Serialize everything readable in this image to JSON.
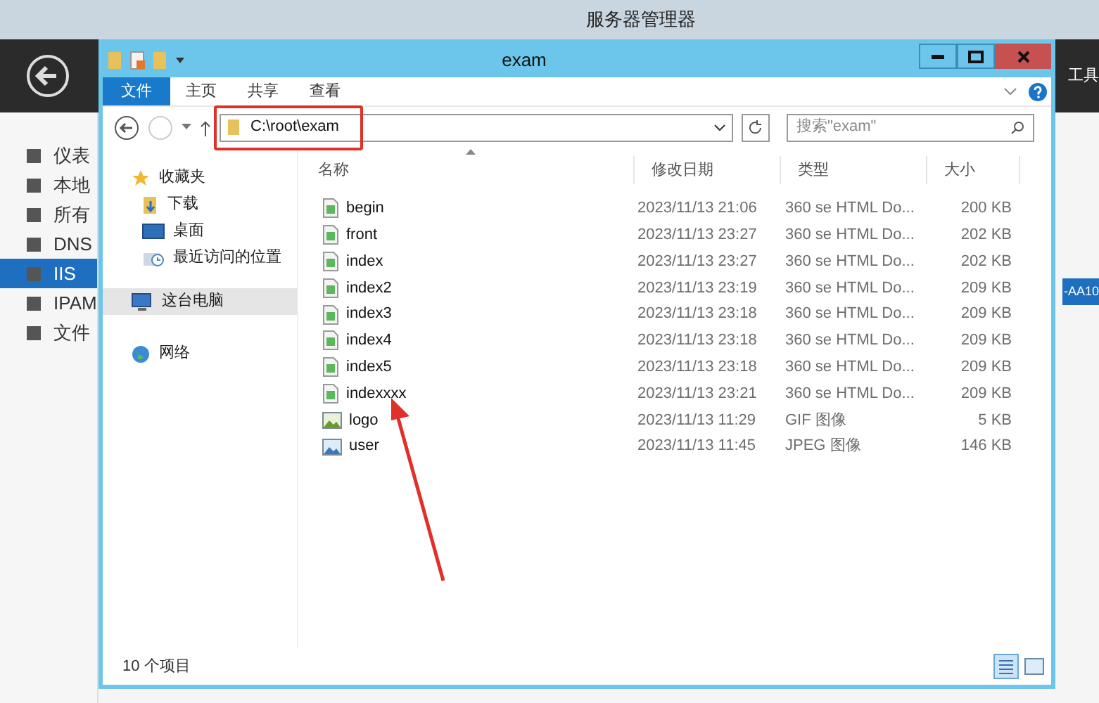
{
  "server_manager": {
    "title": "服务器管理器",
    "tools_menu": "工具",
    "selected_row": "-AA10",
    "sidebar": [
      {
        "label": "仪表",
        "selected": false
      },
      {
        "label": "本地",
        "selected": false
      },
      {
        "label": "所有",
        "selected": false
      },
      {
        "label": "DNS",
        "selected": false
      },
      {
        "label": "IIS",
        "selected": true
      },
      {
        "label": "IPAM",
        "selected": false
      },
      {
        "label": "文件",
        "selected": false
      }
    ]
  },
  "explorer": {
    "title": "exam",
    "ribbon_tabs": [
      {
        "label": "文件",
        "selected": true
      },
      {
        "label": "主页",
        "selected": false
      },
      {
        "label": "共享",
        "selected": false
      },
      {
        "label": "查看",
        "selected": false
      }
    ],
    "address": "C:\\root\\exam",
    "search": {
      "placeholder": "搜索\"exam\""
    },
    "nav": [
      {
        "label": "收藏夹",
        "kind": "favorites",
        "selected": false,
        "children": [
          {
            "label": "下载",
            "kind": "downloads",
            "selected": false
          },
          {
            "label": "桌面",
            "kind": "desktop",
            "selected": false
          },
          {
            "label": "最近访问的位置",
            "kind": "recent",
            "selected": false
          }
        ]
      },
      {
        "label": "这台电脑",
        "kind": "computer",
        "selected": true
      },
      {
        "label": "网络",
        "kind": "network",
        "selected": false
      }
    ],
    "columns": [
      "名称",
      "修改日期",
      "类型",
      "大小"
    ],
    "files": [
      {
        "name": "begin",
        "modified": "2023/11/13 21:06",
        "type": "360 se HTML Do...",
        "size": "200 KB",
        "kind": "html"
      },
      {
        "name": "front",
        "modified": "2023/11/13 23:27",
        "type": "360 se HTML Do...",
        "size": "202 KB",
        "kind": "html"
      },
      {
        "name": "index",
        "modified": "2023/11/13 23:27",
        "type": "360 se HTML Do...",
        "size": "202 KB",
        "kind": "html"
      },
      {
        "name": "index2",
        "modified": "2023/11/13 23:19",
        "type": "360 se HTML Do...",
        "size": "209 KB",
        "kind": "html"
      },
      {
        "name": "index3",
        "modified": "2023/11/13 23:18",
        "type": "360 se HTML Do...",
        "size": "209 KB",
        "kind": "html"
      },
      {
        "name": "index4",
        "modified": "2023/11/13 23:18",
        "type": "360 se HTML Do...",
        "size": "209 KB",
        "kind": "html"
      },
      {
        "name": "index5",
        "modified": "2023/11/13 23:18",
        "type": "360 se HTML Do...",
        "size": "209 KB",
        "kind": "html"
      },
      {
        "name": "indexxxx",
        "modified": "2023/11/13 23:21",
        "type": "360 se HTML Do...",
        "size": "209 KB",
        "kind": "html"
      },
      {
        "name": "logo",
        "modified": "2023/11/13 11:29",
        "type": "GIF 图像",
        "size": "5 KB",
        "kind": "gif"
      },
      {
        "name": "user",
        "modified": "2023/11/13 11:45",
        "type": "JPEG 图像",
        "size": "146 KB",
        "kind": "jpeg"
      }
    ],
    "status": "10 个项目"
  }
}
